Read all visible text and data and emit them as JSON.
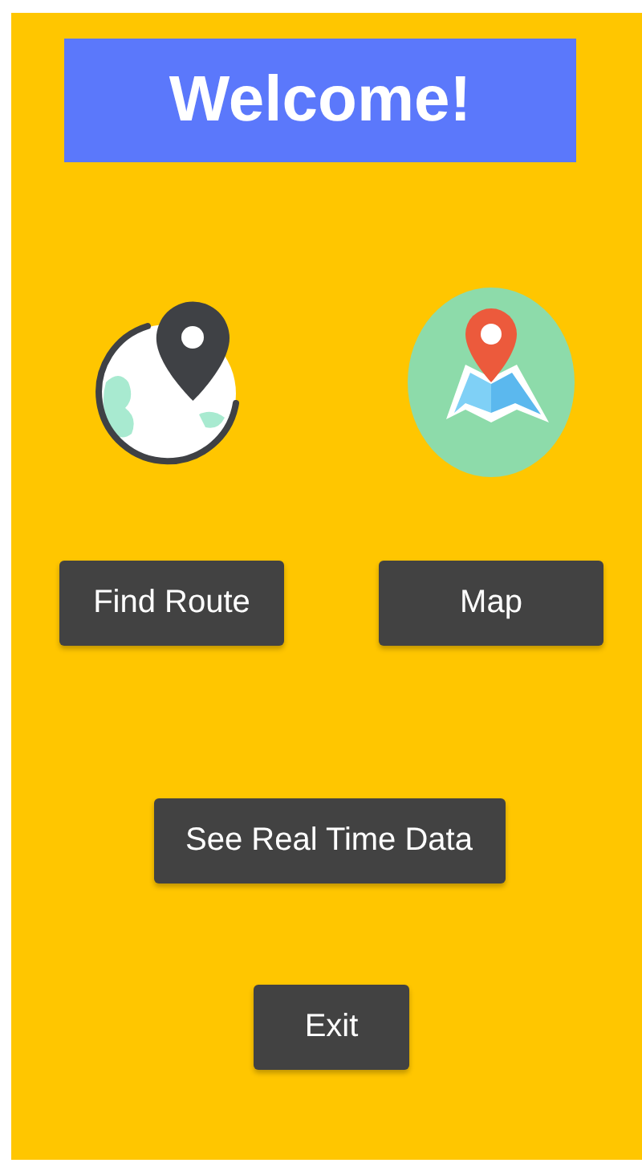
{
  "title": "Welcome!",
  "buttons": [
    {
      "label": "Find Route"
    },
    {
      "label": "Map"
    },
    {
      "label": "See Real Time Data"
    },
    {
      "label": "Exit"
    }
  ]
}
